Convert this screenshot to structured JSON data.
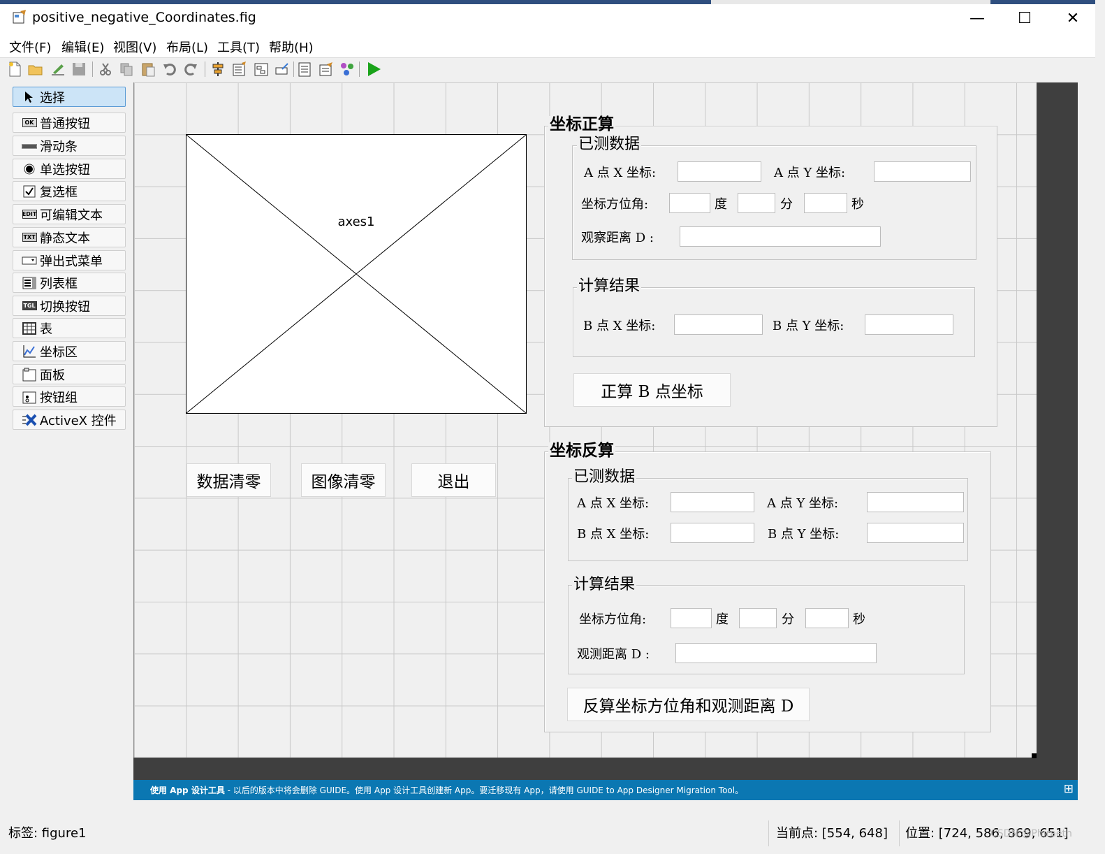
{
  "window": {
    "title": "positive_negative_Coordinates.fig",
    "minimize": "—",
    "maximize": "☐",
    "close": "✕"
  },
  "menu": [
    "文件(F)",
    "编辑(E)",
    "视图(V)",
    "布局(L)",
    "工具(T)",
    "帮助(H)"
  ],
  "toolbar": {
    "icons": [
      "new-file-icon",
      "open-folder-icon",
      "export-icon",
      "save-icon",
      "cut-icon",
      "copy-icon",
      "paste-icon",
      "undo-icon",
      "redo-icon",
      "align-icon",
      "menu-editor-icon",
      "tab-order-icon",
      "toolbar-editor-icon",
      "editor-icon",
      "property-inspector-icon",
      "object-browser-icon",
      "run-icon"
    ]
  },
  "palette": [
    {
      "label": "选择",
      "icon": "arrow-cursor-icon",
      "selected": true
    },
    {
      "label": "普通按钮",
      "icon": "push-button-icon"
    },
    {
      "label": "滑动条",
      "icon": "slider-icon"
    },
    {
      "label": "单选按钮",
      "icon": "radio-button-icon"
    },
    {
      "label": "复选框",
      "icon": "checkbox-icon"
    },
    {
      "label": "可编辑文本",
      "icon": "edit-text-icon"
    },
    {
      "label": "静态文本",
      "icon": "static-text-icon"
    },
    {
      "label": "弹出式菜单",
      "icon": "popup-menu-icon"
    },
    {
      "label": "列表框",
      "icon": "listbox-icon"
    },
    {
      "label": "切换按钮",
      "icon": "toggle-button-icon"
    },
    {
      "label": "表",
      "icon": "table-icon"
    },
    {
      "label": "坐标区",
      "icon": "axes-icon"
    },
    {
      "label": "面板",
      "icon": "panel-icon"
    },
    {
      "label": "按钮组",
      "icon": "button-group-icon"
    },
    {
      "label": "ActiveX 控件",
      "icon": "activex-icon"
    }
  ],
  "canvas": {
    "axes_label": "axes1",
    "buttons": {
      "clear_data": "数据清零",
      "clear_image": "图像清零",
      "exit": "退出"
    },
    "forward": {
      "title": "坐标正算",
      "measured": {
        "title": "已测数据",
        "ax_label": "A 点 X 坐标:",
        "ay_label": "A 点 Y 坐标:",
        "azimuth_label": "坐标方位角:",
        "deg": "度",
        "min": "分",
        "sec": "秒",
        "distance_label": "观察距离 D :"
      },
      "result": {
        "title": "计算结果",
        "bx_label": "B 点 X 坐标:",
        "by_label": "B 点 Y 坐标:"
      },
      "button": "正算 B 点坐标"
    },
    "inverse": {
      "title": "坐标反算",
      "measured": {
        "title": "已测数据",
        "ax_label": "A 点 X 坐标:",
        "ay_label": "A 点 Y 坐标:",
        "bx_label": "B 点 X 坐标:",
        "by_label": "B 点 Y 坐标:"
      },
      "result": {
        "title": "计算结果",
        "azimuth_label": "坐标方位角:",
        "deg": "度",
        "min": "分",
        "sec": "秒",
        "distance_label": "观测距离 D :"
      },
      "button": "反算坐标方位角和观测距离 D"
    }
  },
  "banner": {
    "bold": "使用 App 设计工具",
    "text": " - 以后的版本中将会删除 GUIDE。使用 App 设计工具创建新 App。要迁移现有 App，请使用 GUIDE to App Designer Migration Tool。",
    "expand": "⊞"
  },
  "status": {
    "tag": "标签: figure1",
    "current_point": "当前点:  [554, 648]",
    "position": "位置: [724, 586, 869, 651]",
    "watermark": "CSDN @Phiraeth"
  },
  "colors": {
    "banner": "#0b77b2",
    "dark_area": "#3f3f3f",
    "palette_selected": "#cce4f7",
    "run_icon": "#1aa31a"
  }
}
